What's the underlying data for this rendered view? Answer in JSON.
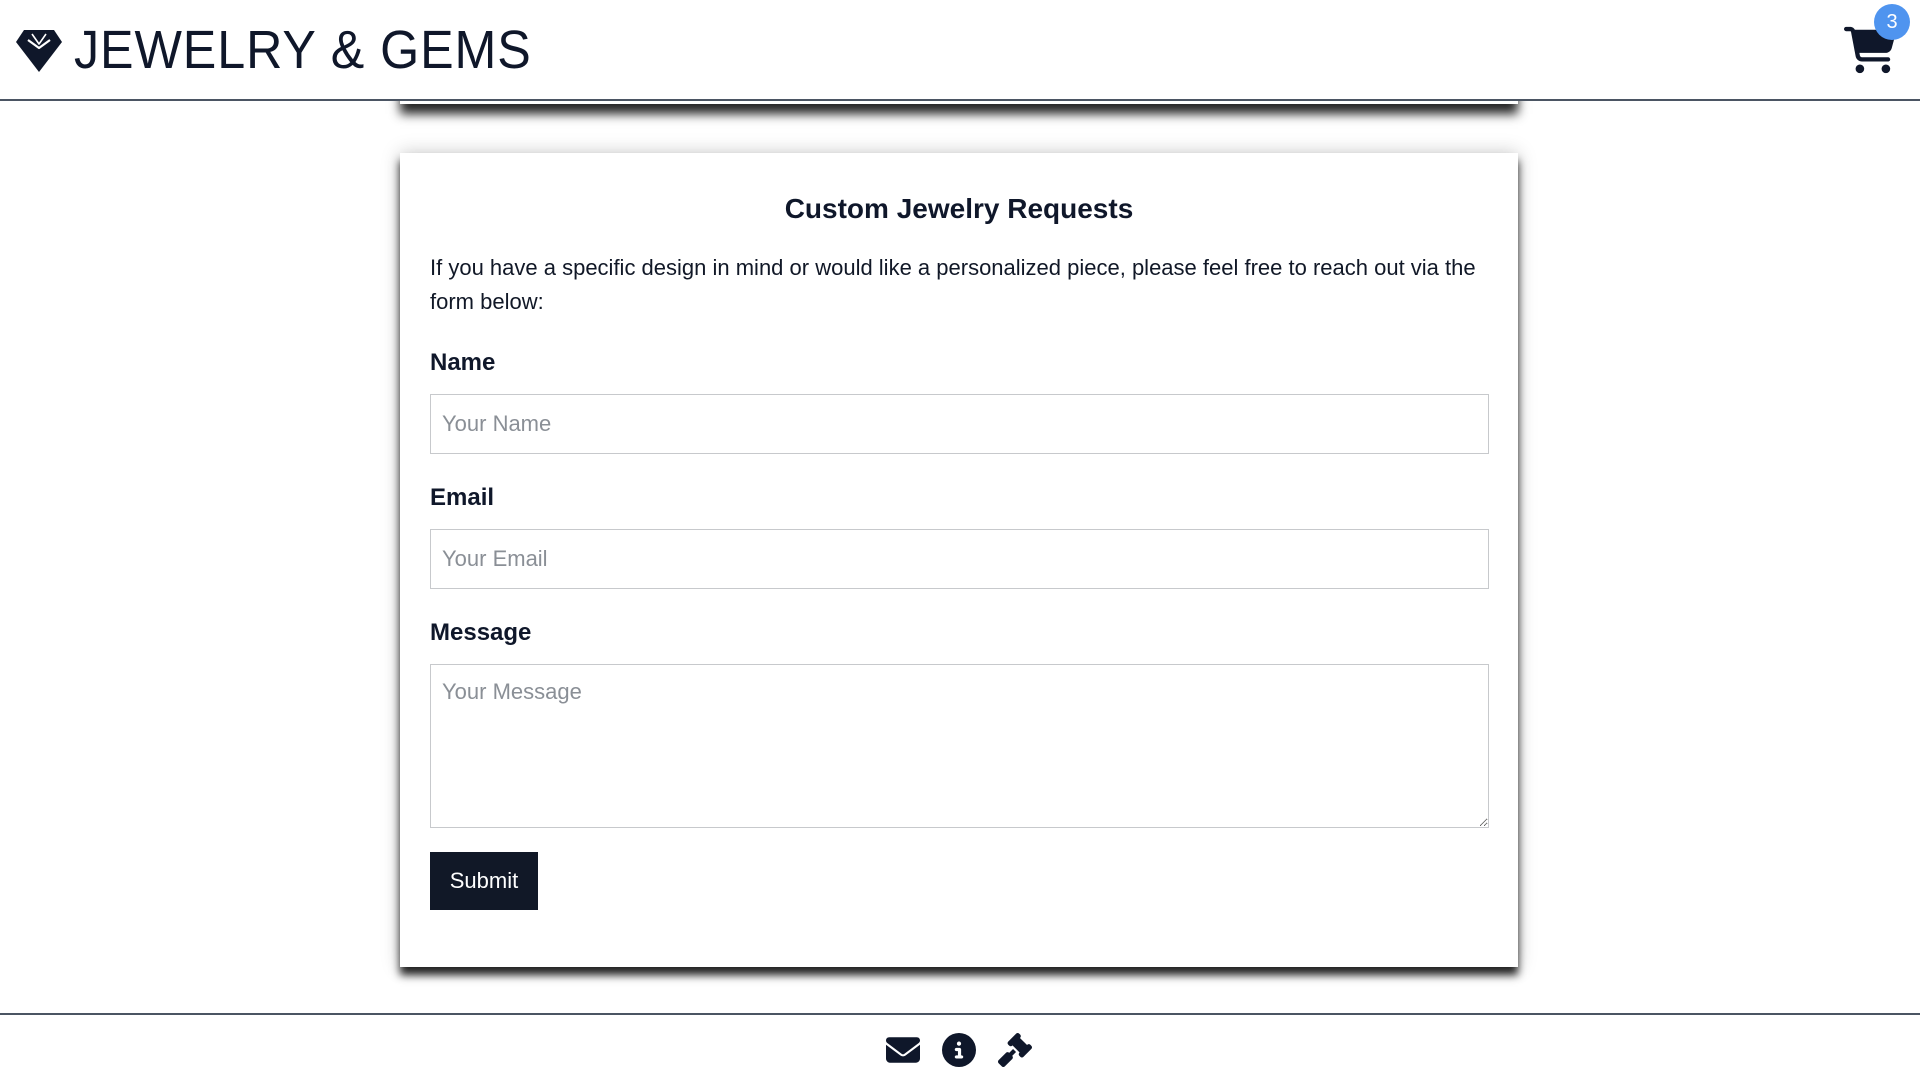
{
  "header": {
    "brand_title": "JEWELRY & GEMS",
    "brand_icon": "gem-icon",
    "cart_icon": "shopping-cart-icon",
    "cart_count": "3",
    "accent_badge_color": "#4f94ef"
  },
  "form": {
    "title": "Custom Jewelry Requests",
    "intro": "If you have a specific design in mind or would like a personalized piece, please feel free to reach out via the form below:",
    "name_label": "Name",
    "name_placeholder": "Your Name",
    "email_label": "Email",
    "email_placeholder": "Your Email",
    "message_label": "Message",
    "message_placeholder": "Your Message",
    "submit_label": "Submit",
    "button_color": "#111827"
  },
  "footer": {
    "icons": [
      "envelope-icon",
      "info-icon",
      "gavel-icon"
    ]
  }
}
